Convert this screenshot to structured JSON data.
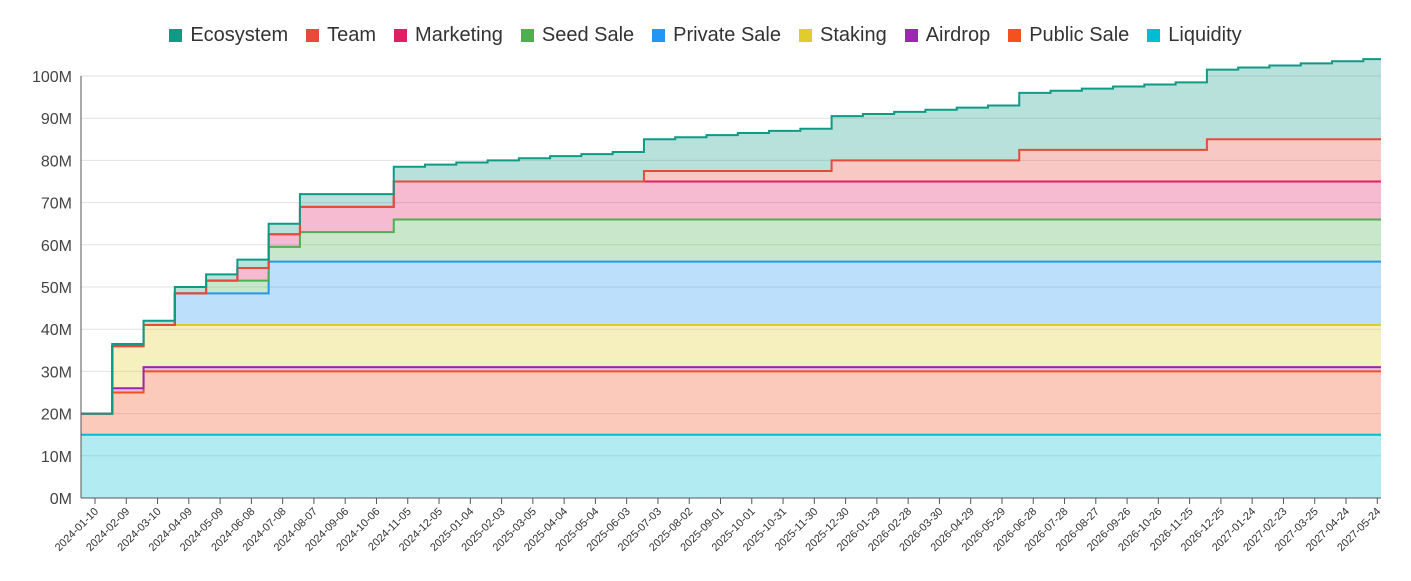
{
  "chart_data": {
    "type": "area",
    "stacked": true,
    "step": true,
    "legend_position": "top",
    "grid": true,
    "ylim": [
      0,
      100
    ],
    "y_ticks": [
      "0M",
      "10M",
      "20M",
      "30M",
      "40M",
      "50M",
      "60M",
      "70M",
      "80M",
      "90M",
      "100M"
    ],
    "x_start": "2024-01-10",
    "x_end": "2027-06-10",
    "x_ticks": [
      "2024-01-10",
      "2024-02-09",
      "2024-03-10",
      "2024-04-09",
      "2024-05-09",
      "2024-06-08",
      "2024-07-08",
      "2024-08-07",
      "2024-09-06",
      "2024-10-06",
      "2024-11-05",
      "2024-12-05",
      "2025-01-04",
      "2025-02-03",
      "2025-03-05",
      "2025-04-04",
      "2025-05-04",
      "2025-06-03",
      "2025-07-03",
      "2025-08-02",
      "2025-09-01",
      "2025-10-01",
      "2025-10-31",
      "2025-11-30",
      "2025-12-30",
      "2026-01-29",
      "2026-02-28",
      "2026-03-30",
      "2026-04-29",
      "2026-05-29",
      "2026-06-28",
      "2026-07-28",
      "2026-08-27",
      "2026-09-26",
      "2026-10-26",
      "2026-11-25",
      "2026-12-25",
      "2027-01-24",
      "2027-02-23",
      "2027-03-25",
      "2027-04-24",
      "2027-05-24"
    ],
    "legend": [
      {
        "name": "Ecosystem",
        "color": "#0f9a85"
      },
      {
        "name": "Team",
        "color": "#e84a3a"
      },
      {
        "name": "Marketing",
        "color": "#e01e64"
      },
      {
        "name": "Seed Sale",
        "color": "#4caf50"
      },
      {
        "name": "Private Sale",
        "color": "#2196f3"
      },
      {
        "name": "Staking",
        "color": "#e0cc2a"
      },
      {
        "name": "Airdrop",
        "color": "#9c27b0"
      },
      {
        "name": "Public Sale",
        "color": "#f4511e"
      },
      {
        "name": "Liquidity",
        "color": "#00bcd4"
      }
    ],
    "stack_order": [
      "Liquidity",
      "Public Sale",
      "Airdrop",
      "Staking",
      "Private Sale",
      "Seed Sale",
      "Marketing",
      "Team",
      "Ecosystem"
    ],
    "series": [
      {
        "name": "Liquidity",
        "color": "#00bcd4",
        "fill": "rgba(0,188,212,0.30)",
        "steps": [
          [
            "2024-01-10",
            15
          ]
        ]
      },
      {
        "name": "Public Sale",
        "color": "#f4511e",
        "fill": "rgba(244,81,30,0.30)",
        "steps": [
          [
            "2024-01-10",
            5
          ],
          [
            "2024-02-09",
            10
          ],
          [
            "2024-03-10",
            15
          ]
        ]
      },
      {
        "name": "Airdrop",
        "color": "#9c27b0",
        "fill": "rgba(156,39,176,0.30)",
        "steps": [
          [
            "2024-01-10",
            0
          ],
          [
            "2024-02-09",
            1
          ],
          [
            "2024-03-10",
            1
          ]
        ]
      },
      {
        "name": "Staking",
        "color": "#e0cc2a",
        "fill": "rgba(224,204,42,0.30)",
        "steps": [
          [
            "2024-01-10",
            0
          ],
          [
            "2024-02-09",
            10
          ],
          [
            "2024-03-10",
            10
          ]
        ]
      },
      {
        "name": "Private Sale",
        "color": "#2196f3",
        "fill": "rgba(33,150,243,0.30)",
        "steps": [
          [
            "2024-01-10",
            0
          ],
          [
            "2024-04-09",
            7.5
          ],
          [
            "2024-07-08",
            15
          ]
        ]
      },
      {
        "name": "Seed Sale",
        "color": "#4caf50",
        "fill": "rgba(76,175,80,0.30)",
        "steps": [
          [
            "2024-01-10",
            0
          ],
          [
            "2024-05-09",
            3
          ],
          [
            "2024-07-08",
            3.5
          ],
          [
            "2024-08-07",
            7
          ],
          [
            "2024-11-05",
            10
          ]
        ]
      },
      {
        "name": "Marketing",
        "color": "#e01e64",
        "fill": "rgba(224,30,100,0.30)",
        "steps": [
          [
            "2024-01-10",
            0
          ],
          [
            "2024-06-08",
            3
          ],
          [
            "2024-07-08",
            3
          ],
          [
            "2024-08-07",
            6
          ],
          [
            "2024-10-06",
            6
          ],
          [
            "2024-11-05",
            9
          ]
        ]
      },
      {
        "name": "Team",
        "color": "#e84a3a",
        "fill": "rgba(232,74,58,0.30)",
        "steps": [
          [
            "2024-01-10",
            0
          ],
          [
            "2025-07-03",
            2.5
          ],
          [
            "2025-12-30",
            5
          ],
          [
            "2026-06-28",
            7.5
          ],
          [
            "2026-12-25",
            10
          ]
        ]
      },
      {
        "name": "Ecosystem",
        "color": "#0f9a85",
        "fill": "rgba(15,154,133,0.30)",
        "steps": [
          [
            "2024-01-10",
            0
          ],
          [
            "2024-02-09",
            0.5
          ],
          [
            "2024-03-10",
            1
          ],
          [
            "2024-04-09",
            1.5
          ],
          [
            "2024-05-09",
            1.5
          ],
          [
            "2024-06-08",
            2
          ],
          [
            "2024-07-08",
            2.5
          ],
          [
            "2024-08-07",
            3
          ],
          [
            "2024-09-06",
            3
          ],
          [
            "2024-10-06",
            3
          ],
          [
            "2024-11-05",
            3.5
          ],
          [
            "2024-12-05",
            4
          ],
          [
            "2025-01-04",
            4.5
          ],
          [
            "2025-02-03",
            5
          ],
          [
            "2025-03-05",
            5.5
          ],
          [
            "2025-04-04",
            6
          ],
          [
            "2025-05-04",
            6.5
          ],
          [
            "2025-06-03",
            7
          ],
          [
            "2025-07-03",
            7.5
          ],
          [
            "2025-08-02",
            8
          ],
          [
            "2025-09-01",
            8.5
          ],
          [
            "2025-10-01",
            9
          ],
          [
            "2025-10-31",
            9.5
          ],
          [
            "2025-11-30",
            10
          ],
          [
            "2025-12-30",
            10.5
          ],
          [
            "2026-01-29",
            11
          ],
          [
            "2026-02-28",
            11.5
          ],
          [
            "2026-03-30",
            12
          ],
          [
            "2026-04-29",
            12.5
          ],
          [
            "2026-05-29",
            13
          ],
          [
            "2026-06-28",
            13.5
          ],
          [
            "2026-07-28",
            14
          ],
          [
            "2026-08-27",
            14.5
          ],
          [
            "2026-09-26",
            15
          ],
          [
            "2026-10-26",
            15.5
          ],
          [
            "2026-11-25",
            16
          ],
          [
            "2026-12-25",
            16.5
          ],
          [
            "2027-01-24",
            17
          ],
          [
            "2027-02-23",
            17.5
          ],
          [
            "2027-03-25",
            18
          ],
          [
            "2027-04-24",
            18.5
          ],
          [
            "2027-05-24",
            19
          ]
        ]
      }
    ]
  }
}
